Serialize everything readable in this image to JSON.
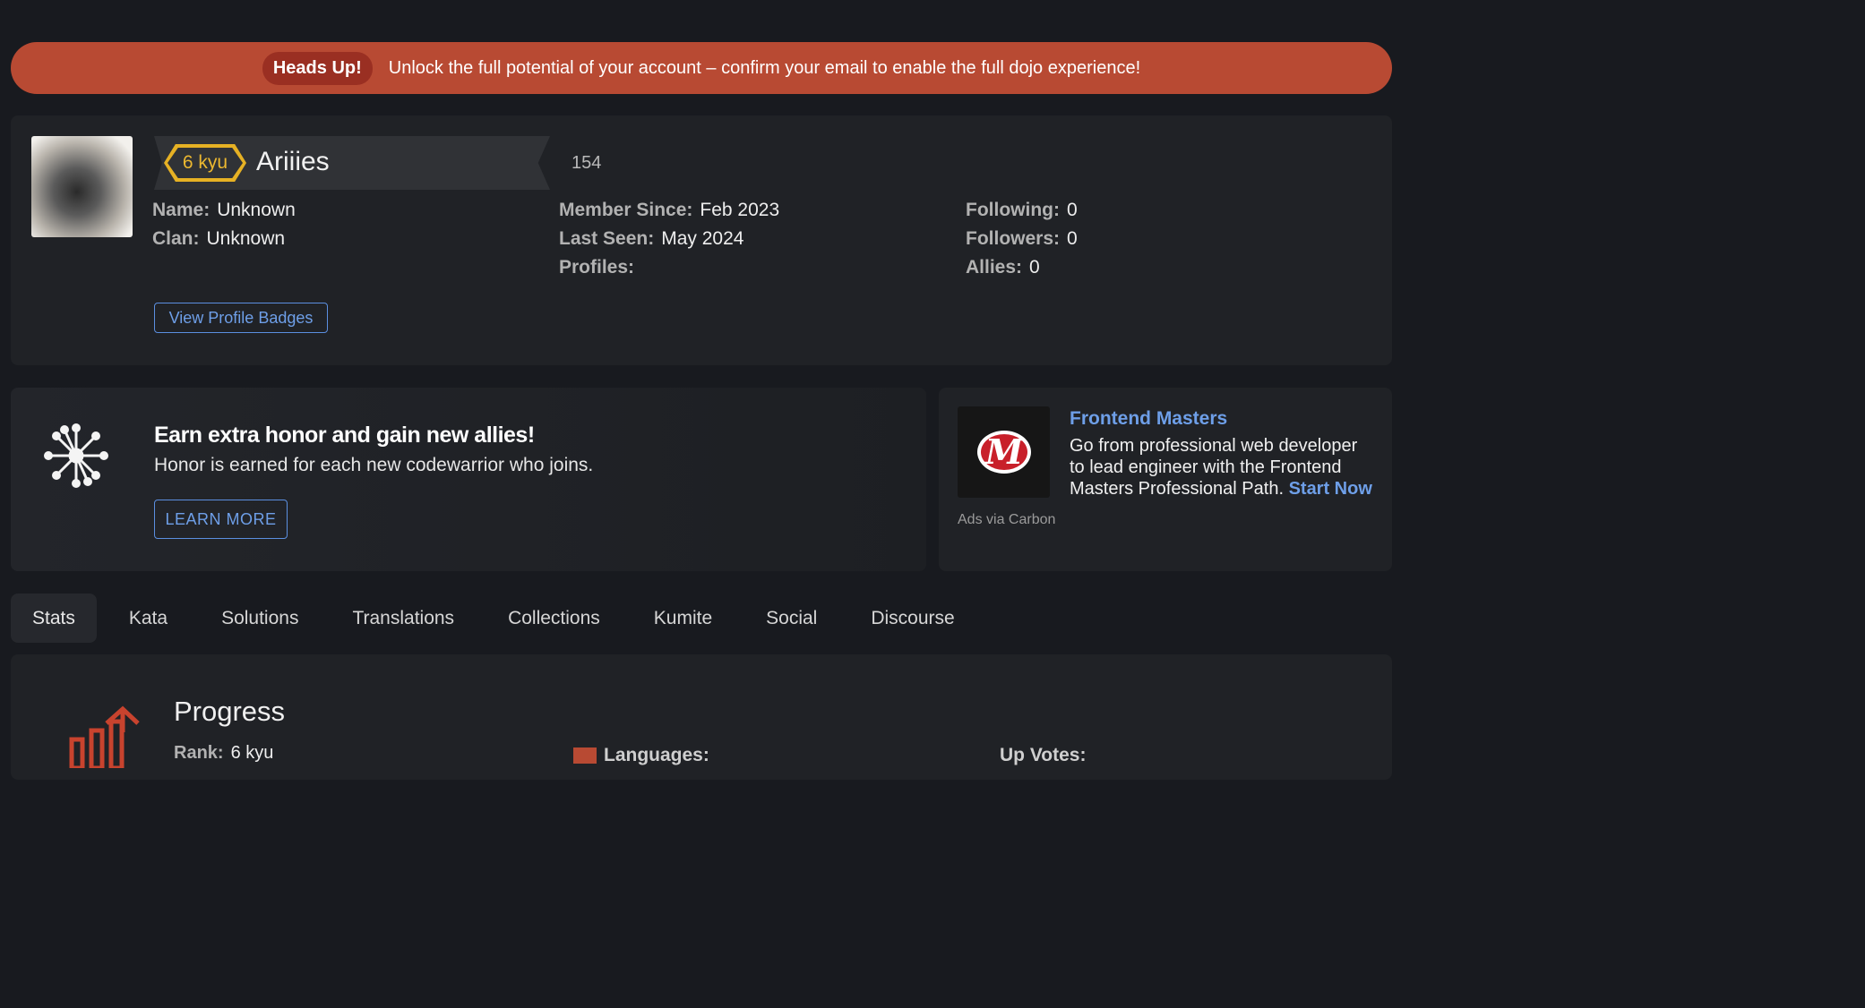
{
  "banner": {
    "pill": "Heads Up!",
    "text": "Unlock the full potential of your account – confirm your email to enable the full dojo experience!"
  },
  "profile": {
    "rank": "6 kyu",
    "username": "Ariiies",
    "honor": "154",
    "col1": [
      {
        "key": "Name:",
        "value": "Unknown"
      },
      {
        "key": "Clan:",
        "value": "Unknown"
      }
    ],
    "col2": [
      {
        "key": "Member Since:",
        "value": "Feb 2023"
      },
      {
        "key": "Last Seen:",
        "value": "May 2024"
      },
      {
        "key": "Profiles:",
        "value": ""
      }
    ],
    "col3": [
      {
        "key": "Following:",
        "value": "0"
      },
      {
        "key": "Followers:",
        "value": "0"
      },
      {
        "key": "Allies:",
        "value": "0"
      }
    ],
    "badges_button": "View Profile Badges"
  },
  "referral": {
    "title": "Earn extra honor and gain new allies!",
    "subtitle": "Honor is earned for each new codewarrior who joins.",
    "button": "LEARN MORE"
  },
  "ad": {
    "title": "Frontend Masters",
    "text": "Go from professional web developer to lead engineer with the Frontend Masters Professional Path.",
    "cta": "Start Now",
    "via": "Ads via Carbon",
    "logo_letter": "M"
  },
  "tabs": [
    "Stats",
    "Kata",
    "Solutions",
    "Translations",
    "Collections",
    "Kumite",
    "Social",
    "Discourse"
  ],
  "stats": {
    "title": "Progress",
    "rank_key": "Rank:",
    "rank_value": "6 kyu",
    "languages_label": "Languages:",
    "upvotes_label": "Up Votes:"
  },
  "colors": {
    "accent_orange": "#b84a33",
    "link_blue": "#6e9fe8",
    "rank_yellow": "#e6b124"
  }
}
